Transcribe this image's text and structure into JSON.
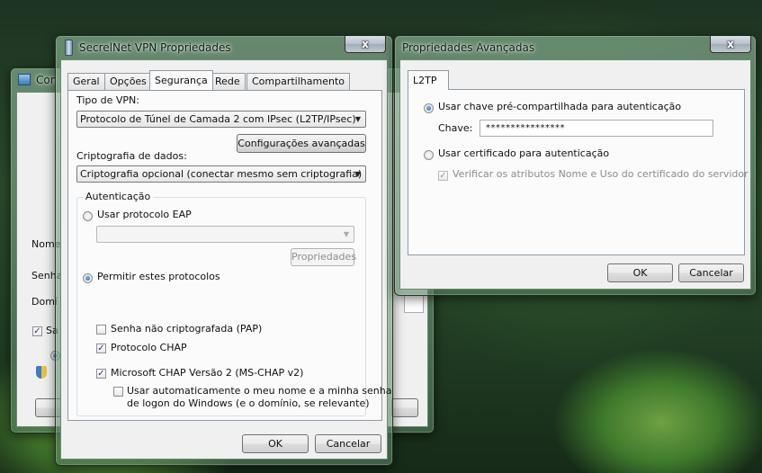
{
  "back_window": {
    "title": "Con",
    "labels": {
      "nome": "Nome",
      "senha": "Senha",
      "dominio": "Domí",
      "save_check": "Sa"
    }
  },
  "vpn_window": {
    "title": "SecrelNet VPN Propriedades",
    "close_label": "x",
    "tabs": [
      "Geral",
      "Opções",
      "Segurança",
      "Rede",
      "Compartilhamento"
    ],
    "active_tab": "Segurança",
    "vpn_type_label": "Tipo de VPN:",
    "vpn_type_value": "Protocolo de Túnel de Camada 2 com IPsec (L2TP/IPsec)",
    "advanced_button": "Configurações avançadas",
    "encryption_label": "Criptografia de dados:",
    "encryption_value": "Criptografia opcional (conectar mesmo sem criptografia)",
    "auth_group": "Autenticação",
    "eap_radio": "Usar protocolo EAP",
    "eap_select_value": "",
    "properties_button": "Propriedades",
    "allow_protocols_radio": "Permitir estes protocolos",
    "pap_check": "Senha não criptografada (PAP)",
    "chap_check": "Protocolo CHAP",
    "mschap_check": "Microsoft CHAP Versão 2 (MS-CHAP v2)",
    "auto_logon_line1": "Usar automaticamente o meu nome e a minha senha",
    "auto_logon_line2": "de logon do Windows (e o domínio, se relevante)",
    "states": {
      "eap": false,
      "allow": true,
      "pap": false,
      "chap": true,
      "mschap": true,
      "auto_logon": false
    },
    "ok_button": "OK",
    "cancel_button": "Cancelar"
  },
  "advanced_window": {
    "title": "Propriedades Avançadas",
    "close_label": "x",
    "tab": "L2TP",
    "psk_radio": "Usar chave pré-compartilhada para autenticação",
    "key_label": "Chave:",
    "key_value": "****************",
    "cert_radio": "Usar certificado para autenticação",
    "verify_check": "Verificar os atributos Nome e Uso do certificado do servidor",
    "states": {
      "psk": true,
      "cert": false,
      "verify": true
    },
    "ok_button": "OK",
    "cancel_button": "Cancelar"
  },
  "glyphs": {
    "check": "✓",
    "arrow": "▼"
  }
}
